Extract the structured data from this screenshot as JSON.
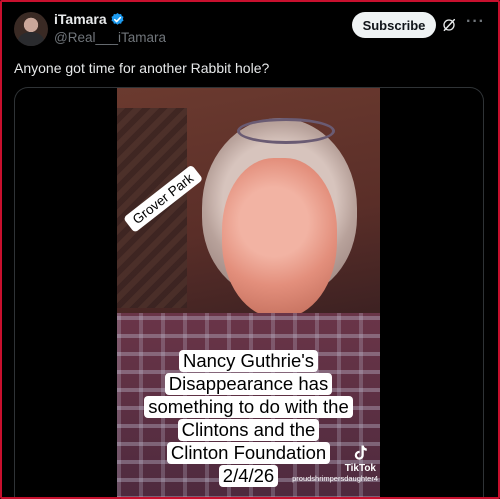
{
  "author": {
    "display_name": "iTamara",
    "handle": "@Real___iTamara",
    "verified": true
  },
  "actions": {
    "subscribe_label": "Subscribe",
    "grok_icon": "grok-icon",
    "more_icon": "more-icon",
    "more_glyph": "···"
  },
  "tweet": {
    "text": "Anyone got time for another Rabbit hole?"
  },
  "video": {
    "location_tag": "Grover Park",
    "caption_lines": [
      "Nancy Guthrie's",
      "Disappearance has",
      "something to do with the",
      "Clintons and the",
      "Clinton Foundation",
      "2/4/26"
    ],
    "watermark_brand": "TikTok",
    "watermark_user": "proudshrimpersdaughter4"
  },
  "colors": {
    "background": "#000000",
    "text_primary": "#e7e9ea",
    "text_secondary": "#71767b",
    "verified_blue": "#1d9bf0",
    "subscribe_bg": "#eff3f4",
    "frame_red": "#c8102e"
  }
}
